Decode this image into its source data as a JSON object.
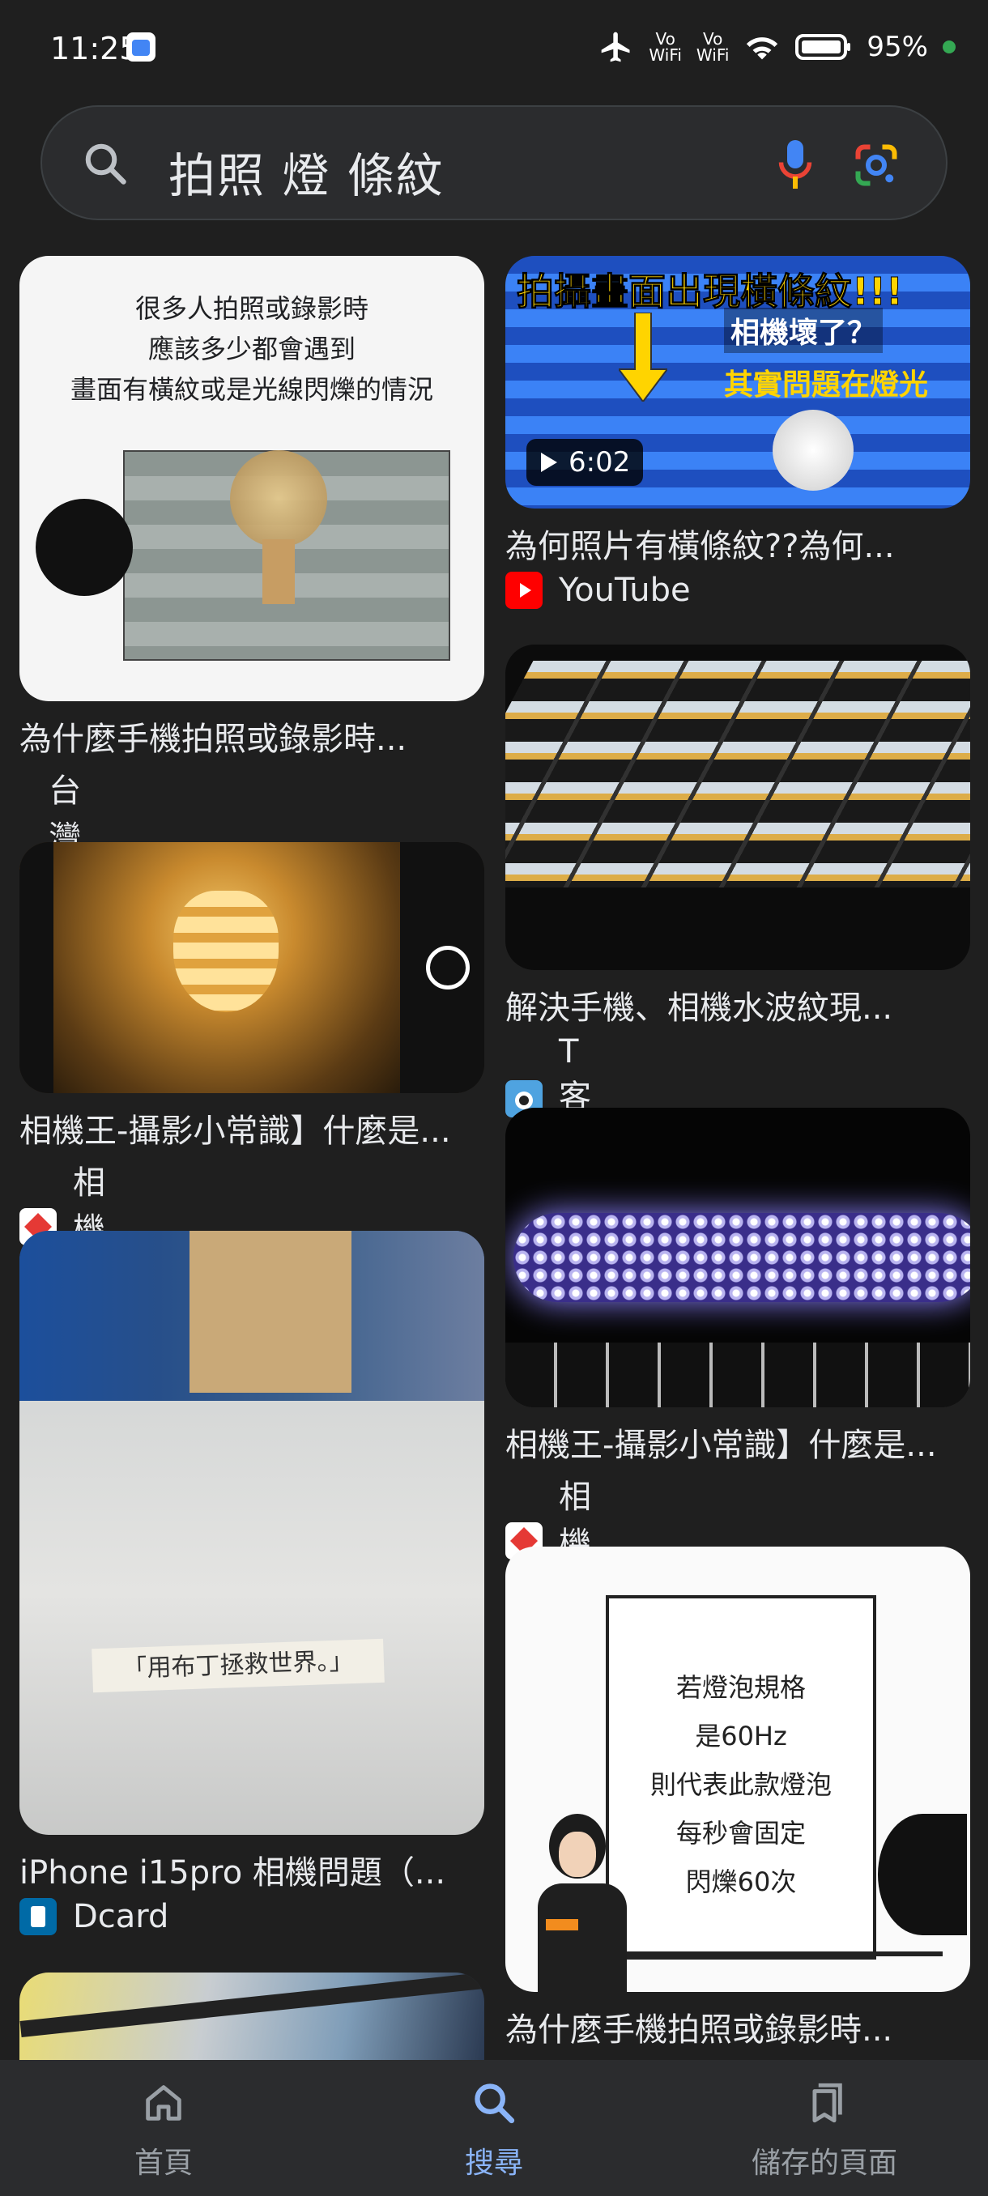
{
  "status": {
    "time": "11:25",
    "vo1_top": "Vo",
    "vo1_bottom": "WiFi",
    "vo2_top": "Vo",
    "vo2_bottom": "WiFi",
    "battery": "95%"
  },
  "search": {
    "query": "拍照 燈 條紋"
  },
  "results": [
    {
      "title": "為什麼手機拍照或錄影時...",
      "source": "台灣大哥大",
      "caption_lines": [
        "很多人拍照或錄影時",
        "應該多少都會遇到",
        "畫面有橫紋或是光線閃爍的情況"
      ]
    },
    {
      "title": "為何照片有橫條紋??為何...",
      "source": "YouTube",
      "overlay_title": "拍攝畫面出現橫條紋!!!",
      "overlay_sub1": "相機壞了？",
      "overlay_sub2": "其實問題在燈光",
      "duration": "6:02"
    },
    {
      "title": "解決手機、相機水波紋現...",
      "source": "T客邦"
    },
    {
      "title": "相機王-攝影小常識】什麼是...",
      "source": "相機王"
    },
    {
      "title": "相機王-攝影小常識】什麼是...",
      "source": "相機王"
    },
    {
      "title": "iPhone i15pro 相機問題（...",
      "source": "Dcard",
      "note_text": "「用布丁拯救世界。」"
    },
    {
      "title": "為什麼手機拍照或錄影時...",
      "source": "",
      "board_lines": [
        "若燈泡規格",
        "是60Hz",
        "則代表此款燈泡",
        "每秒會固定",
        "閃爍60次"
      ]
    }
  ],
  "nav": {
    "home": "首頁",
    "search": "搜尋",
    "saved": "儲存的頁面"
  }
}
